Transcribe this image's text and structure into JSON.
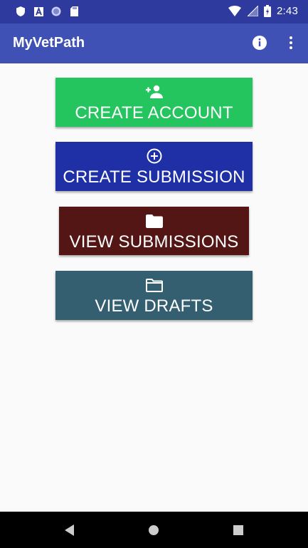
{
  "status_bar": {
    "time": "2:43",
    "notification_icons": [
      "shield-icon",
      "font-a-icon",
      "sync-circle-icon",
      "sd-card-icon"
    ],
    "system_icons": [
      "wifi-icon",
      "signal-icon",
      "battery-icon"
    ]
  },
  "app_bar": {
    "title": "MyVetPath",
    "actions": [
      "info-icon",
      "more-vert-icon"
    ],
    "color": "#3f51b5",
    "status_color": "#2e3a9e"
  },
  "main": {
    "buttons": [
      {
        "label": "CREATE ACCOUNT",
        "icon": "person-add-icon",
        "color": "#24c55e"
      },
      {
        "label": "CREATE SUBMISSION",
        "icon": "add-circle-icon",
        "color": "#1f2fa5"
      },
      {
        "label": "VIEW SUBMISSIONS",
        "icon": "folder-filled-icon",
        "color": "#541515"
      },
      {
        "label": "VIEW DRAFTS",
        "icon": "folder-outline-icon",
        "color": "#335f70"
      }
    ]
  },
  "nav_bar": {
    "items": [
      "back-icon",
      "home-icon",
      "recents-icon"
    ]
  }
}
